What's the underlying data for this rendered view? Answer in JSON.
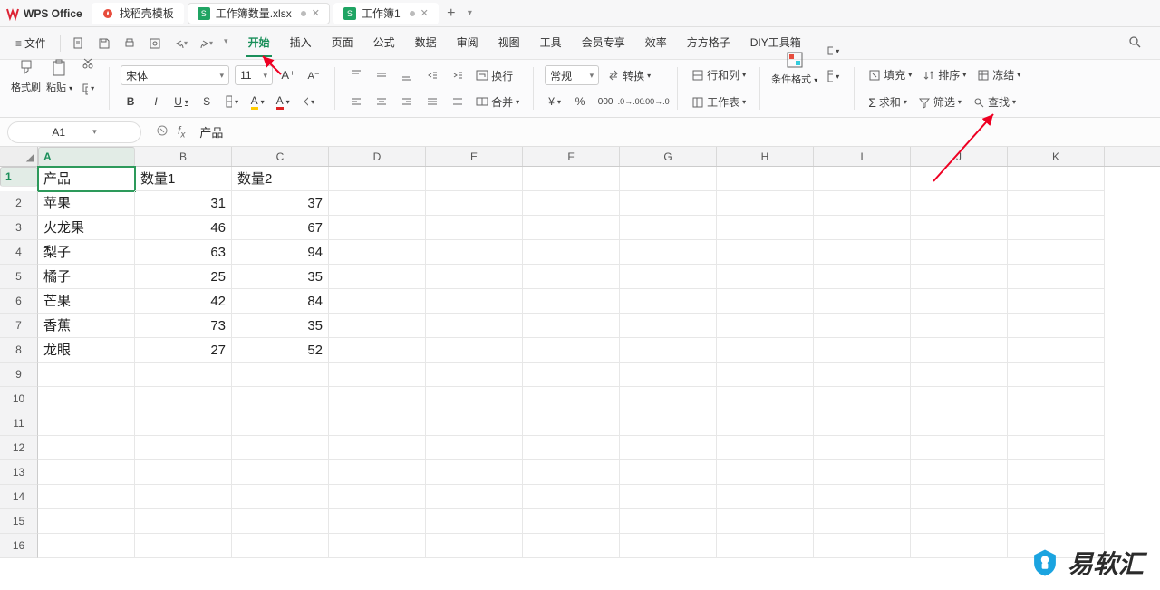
{
  "titlebar": {
    "app_name": "WPS Office",
    "template_tab": "找稻壳模板",
    "tabs": [
      {
        "icon": "S",
        "label": "工作簿数量.xlsx",
        "modified": true
      },
      {
        "icon": "S",
        "label": "工作簿1",
        "modified": true
      }
    ]
  },
  "menubar": {
    "file_label": "文件",
    "menu_items": [
      "开始",
      "插入",
      "页面",
      "公式",
      "数据",
      "审阅",
      "视图",
      "工具",
      "会员专享",
      "效率",
      "方方格子",
      "DIY工具箱"
    ],
    "active_index": 0
  },
  "ribbon": {
    "format_painter": "格式刷",
    "paste": "粘贴",
    "font_name": "宋体",
    "font_size": "11",
    "wrap_text": "换行",
    "merge": "合并",
    "number_format": "常规",
    "transform": "转换",
    "row_col": "行和列",
    "worksheet": "工作表",
    "cond_format": "条件格式",
    "fill": "填充",
    "sum": "求和",
    "sort": "排序",
    "filter": "筛选",
    "freeze": "冻结",
    "find": "查找"
  },
  "formulabar": {
    "cell_ref": "A1",
    "fx_value": "产品"
  },
  "columns": [
    "A",
    "B",
    "C",
    "D",
    "E",
    "F",
    "G",
    "H",
    "I",
    "J",
    "K"
  ],
  "row_numbers": [
    "1",
    "2",
    "3",
    "4",
    "5",
    "6",
    "7",
    "8",
    "9",
    "10",
    "11",
    "12",
    "13",
    "14",
    "15",
    "16"
  ],
  "data": {
    "header": [
      "产品",
      "数量1",
      "数量2"
    ],
    "rows": [
      [
        "苹果",
        "31",
        "37"
      ],
      [
        "火龙果",
        "46",
        "67"
      ],
      [
        "梨子",
        "63",
        "94"
      ],
      [
        "橘子",
        "25",
        "35"
      ],
      [
        "芒果",
        "42",
        "84"
      ],
      [
        "香蕉",
        "73",
        "35"
      ],
      [
        "龙眼",
        "27",
        "52"
      ]
    ]
  },
  "watermark": "易软汇"
}
